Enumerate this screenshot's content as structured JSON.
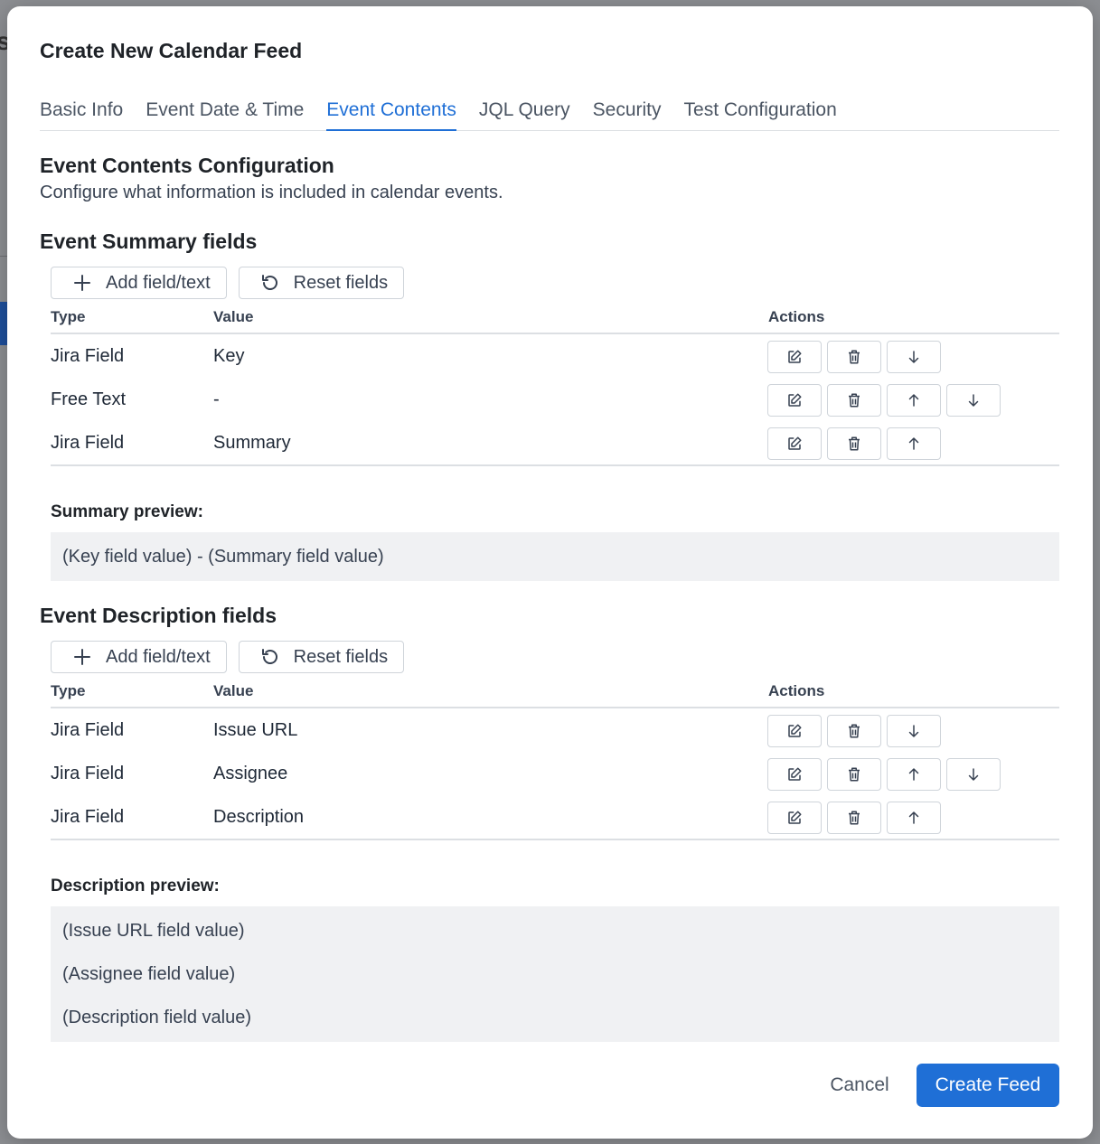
{
  "modal": {
    "title": "Create New Calendar Feed",
    "tabs": [
      {
        "label": "Basic Info"
      },
      {
        "label": "Event Date & Time"
      },
      {
        "label": "Event Contents"
      },
      {
        "label": "JQL Query"
      },
      {
        "label": "Security"
      },
      {
        "label": "Test Configuration"
      }
    ],
    "active_tab": "Event Contents",
    "section": {
      "heading": "Event Contents Configuration",
      "subtitle": "Configure what information is included in calendar events."
    },
    "summary": {
      "heading": "Event Summary fields",
      "add_label": "Add field/text",
      "reset_label": "Reset fields",
      "col_type": "Type",
      "col_value": "Value",
      "col_actions": "Actions",
      "rows": [
        {
          "type": "Jira Field",
          "value": "Key"
        },
        {
          "type": "Free Text",
          "value": "-"
        },
        {
          "type": "Jira Field",
          "value": "Summary"
        }
      ],
      "preview_label": "Summary preview:",
      "preview_lines": [
        "(Key field value) - (Summary field value)"
      ]
    },
    "description": {
      "heading": "Event Description fields",
      "add_label": "Add field/text",
      "reset_label": "Reset fields",
      "col_type": "Type",
      "col_value": "Value",
      "col_actions": "Actions",
      "rows": [
        {
          "type": "Jira Field",
          "value": "Issue URL"
        },
        {
          "type": "Jira Field",
          "value": "Assignee"
        },
        {
          "type": "Jira Field",
          "value": "Description"
        }
      ],
      "preview_label": "Description preview:",
      "preview_lines": [
        "(Issue URL field value)",
        "(Assignee field value)",
        "(Description field value)"
      ]
    },
    "footer": {
      "cancel_label": "Cancel",
      "create_label": "Create Feed"
    }
  },
  "colors": {
    "accent": "#1f6fd6",
    "preview_bg": "#f0f1f3",
    "border": "#cfd4da"
  },
  "icons": {
    "add": "plus-icon",
    "reset": "reset-icon",
    "edit": "edit-icon",
    "delete": "trash-icon",
    "move_up": "arrow-up-icon",
    "move_down": "arrow-down-icon"
  }
}
